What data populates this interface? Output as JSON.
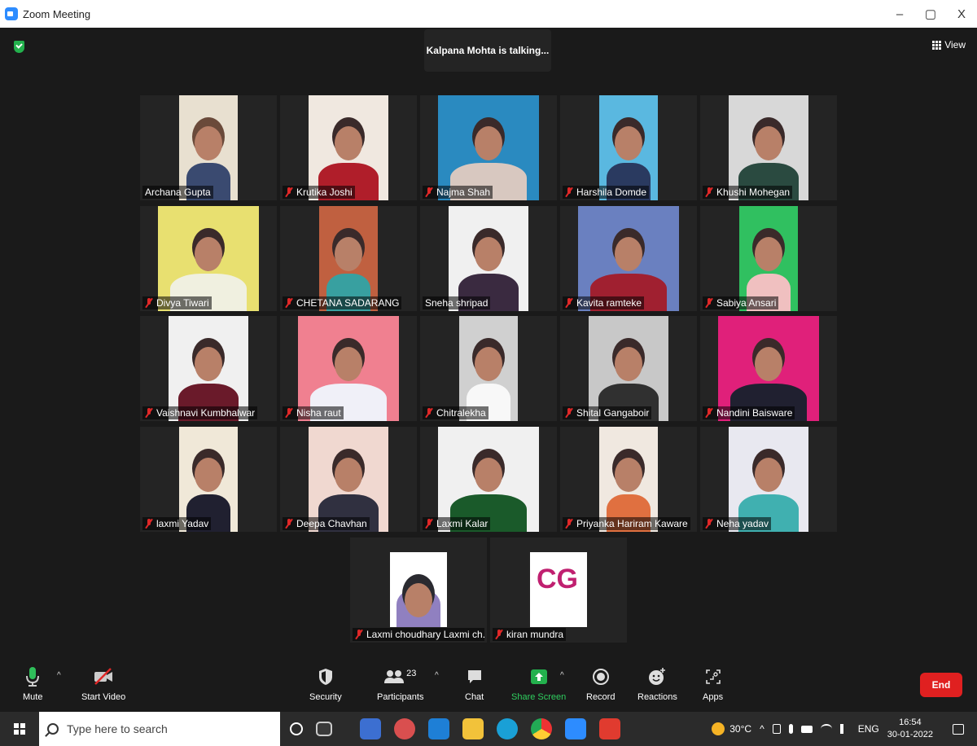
{
  "window": {
    "title": "Zoom Meeting",
    "controls": [
      "–",
      "▢",
      "X"
    ]
  },
  "meeting": {
    "talking_banner": "Kalpana Mohta is talking...",
    "view_label": "View"
  },
  "participants": [
    {
      "name": "Archana Gupta",
      "muted": false
    },
    {
      "name": "Krutika Joshi",
      "muted": true
    },
    {
      "name": "Najma Shah",
      "muted": true
    },
    {
      "name": "Harshila Domde",
      "muted": true
    },
    {
      "name": "Khushi Mohegan",
      "muted": true
    },
    {
      "name": "Divya Tiwari",
      "muted": true
    },
    {
      "name": "CHETANA SADARANG",
      "muted": true
    },
    {
      "name": "Sneha shripad",
      "muted": false
    },
    {
      "name": "Kavita ramteke",
      "muted": true
    },
    {
      "name": "Sabiya Ansari",
      "muted": true
    },
    {
      "name": "Vaishnavi Kumbhalwar",
      "muted": true
    },
    {
      "name": "Nisha raut",
      "muted": true
    },
    {
      "name": "Chitralekha",
      "muted": true
    },
    {
      "name": "Shital Gangaboir",
      "muted": true
    },
    {
      "name": "Nandini Baisware",
      "muted": true
    },
    {
      "name": "laxmi Yadav",
      "muted": true
    },
    {
      "name": "Deepa Chavhan",
      "muted": true
    },
    {
      "name": "Laxmi Kalar",
      "muted": true
    },
    {
      "name": "Priyanka Hariram Kaware",
      "muted": true
    },
    {
      "name": "Neha yadav",
      "muted": true
    },
    {
      "name": "Laxmi choudhary Laxmi ch...",
      "muted": true
    },
    {
      "name": "kiran mundra",
      "muted": true
    }
  ],
  "toolbar": {
    "mute": "Mute",
    "start_video": "Start Video",
    "security": "Security",
    "participants": "Participants",
    "participants_count": "23",
    "chat": "Chat",
    "share_screen": "Share Screen",
    "record": "Record",
    "reactions": "Reactions",
    "apps": "Apps",
    "end": "End"
  },
  "taskbar": {
    "search_placeholder": "Type here to search",
    "temperature": "30°C",
    "language": "ENG",
    "time": "16:54",
    "date": "30-01-2022"
  },
  "colors": {
    "accent_green": "#23b14d",
    "end_red": "#e02020",
    "zoom_blue": "#2d8cff"
  }
}
